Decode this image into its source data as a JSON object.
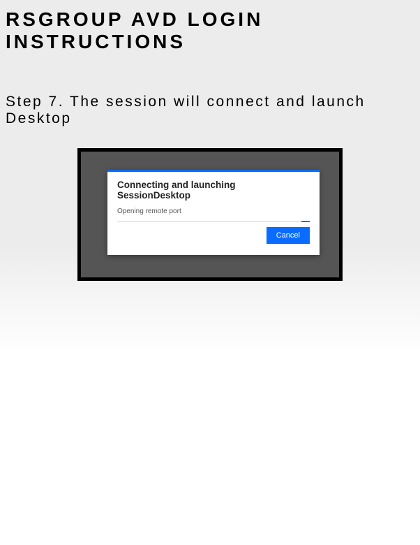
{
  "page": {
    "title": "RSGROUP AVD LOGIN INSTRUCTIONS",
    "step": "Step 7. The session will connect and launch Desktop"
  },
  "dialog": {
    "title": "Connecting and launching SessionDesktop",
    "status": "Opening remote port",
    "cancel_label": "Cancel"
  },
  "colors": {
    "accent": "#0a6cff"
  }
}
